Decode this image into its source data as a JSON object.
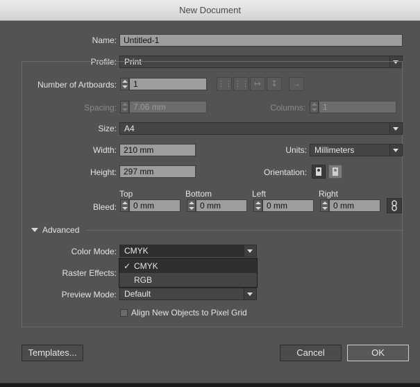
{
  "window": {
    "title": "New Document"
  },
  "name": {
    "label": "Name:",
    "value": "Untitled-1"
  },
  "profile": {
    "label": "Profile:",
    "value": "Print"
  },
  "artboards": {
    "label": "Number of Artboards:",
    "value": "1"
  },
  "spacing": {
    "label": "Spacing:",
    "value": "7.06 mm"
  },
  "columns": {
    "label": "Columns:",
    "value": "1"
  },
  "size": {
    "label": "Size:",
    "value": "A4"
  },
  "width": {
    "label": "Width:",
    "value": "210 mm"
  },
  "units": {
    "label": "Units:",
    "value": "Millimeters"
  },
  "height": {
    "label": "Height:",
    "value": "297 mm"
  },
  "orientation": {
    "label": "Orientation:"
  },
  "bleed": {
    "label": "Bleed:",
    "top_label": "Top",
    "top": "0 mm",
    "bottom_label": "Bottom",
    "bottom": "0 mm",
    "left_label": "Left",
    "left": "0 mm",
    "right_label": "Right",
    "right": "0 mm"
  },
  "advanced": {
    "label": "Advanced"
  },
  "color_mode": {
    "label": "Color Mode:",
    "value": "CMYK",
    "options": [
      "CMYK",
      "RGB"
    ]
  },
  "raster_effects": {
    "label": "Raster Effects:"
  },
  "preview_mode": {
    "label": "Preview Mode:",
    "value": "Default"
  },
  "align_pixel_grid": {
    "label": "Align New Objects to Pixel Grid"
  },
  "buttons": {
    "templates": "Templates...",
    "cancel": "Cancel",
    "ok": "OK"
  }
}
